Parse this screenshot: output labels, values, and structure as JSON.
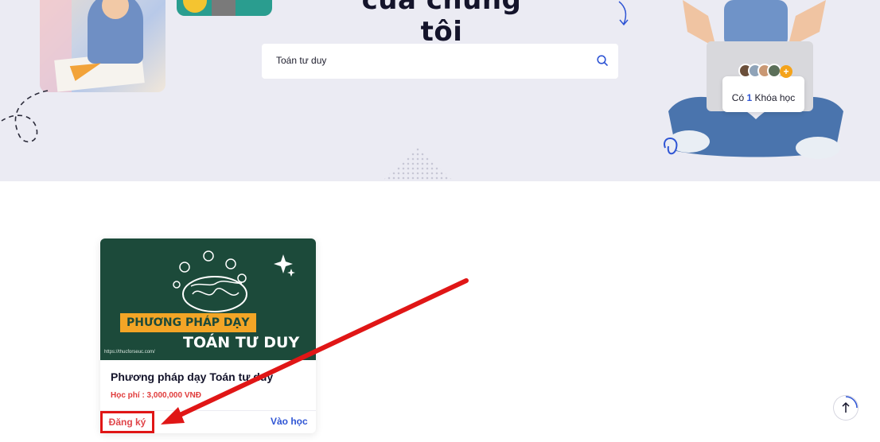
{
  "hero": {
    "title": "của chúng tôi",
    "search": {
      "value": "Toán tư duy"
    },
    "course_count": {
      "prefix": "Có",
      "number": "1",
      "suffix": "Khóa học"
    }
  },
  "course": {
    "thumbnail": {
      "tag": "PHƯƠNG PHÁP DẠY",
      "main": "TOÁN TƯ DUY",
      "url": "https://thucforseuc.com/"
    },
    "title": "Phương pháp dạy Toán tư duy",
    "price": "Học phí : 3,000,000 VNĐ",
    "register_label": "Đăng ký",
    "learn_label": "Vào học"
  },
  "colors": {
    "hero_bg": "#ebebf3",
    "accent_blue": "#2f55d4",
    "price_red": "#e03b3b",
    "annotation_red": "#e01616",
    "thumb_green": "#1c4a3a",
    "thumb_orange": "#f3a526"
  },
  "icons": [
    "search-icon",
    "arrow-up-icon",
    "plus-icon"
  ]
}
